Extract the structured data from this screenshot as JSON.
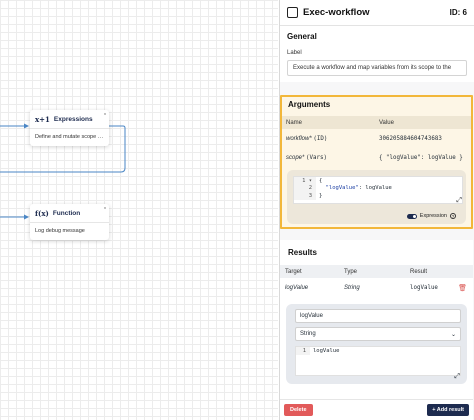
{
  "canvas": {
    "nodes": [
      {
        "icon": "x+1",
        "title": "Expressions",
        "body": "Define and mutate scope v...",
        "badge": "x"
      },
      {
        "icon": "f(x)",
        "title": "Function",
        "body": "Log debug message",
        "badge": "x"
      }
    ]
  },
  "panel": {
    "title": "Exec-workflow",
    "id_label": "ID: 6",
    "general": {
      "title": "General",
      "label_caption": "Label",
      "label_value": "Execute a workflow and map variables from its scope to the"
    },
    "arguments": {
      "title": "Arguments",
      "columns": [
        "Name",
        "Value"
      ],
      "rows": [
        {
          "name": "workflow*",
          "type": "(ID)",
          "value": "306205884604743683"
        },
        {
          "name": "scope*",
          "type": "(Vars)",
          "value": "{ \"logValue\": logValue }"
        }
      ],
      "code_lines": [
        {
          "num": "1",
          "marker": "▾",
          "text": "{"
        },
        {
          "num": "2",
          "marker": "",
          "text_key": "  \"logValue\"",
          "text_rest": ": logValue"
        },
        {
          "num": "3",
          "marker": "",
          "text": "}"
        }
      ],
      "toggle_label": "Expression"
    },
    "results": {
      "title": "Results",
      "columns": [
        "Target",
        "Type",
        "Result"
      ],
      "rows": [
        {
          "target": "logValue",
          "type": "String",
          "result": "logValue"
        }
      ],
      "editor": {
        "target_value": "logValue",
        "type_selected": "String",
        "code_line_num": "1",
        "code_text": "logValue"
      }
    },
    "footer": {
      "delete_label": "Delete",
      "add_label": "+ Add result"
    }
  },
  "colors": {
    "accent": "#1d2b4f",
    "highlight_border": "#f2b73a",
    "highlight_bg": "#fdf6e6",
    "danger": "#e25a5a"
  }
}
